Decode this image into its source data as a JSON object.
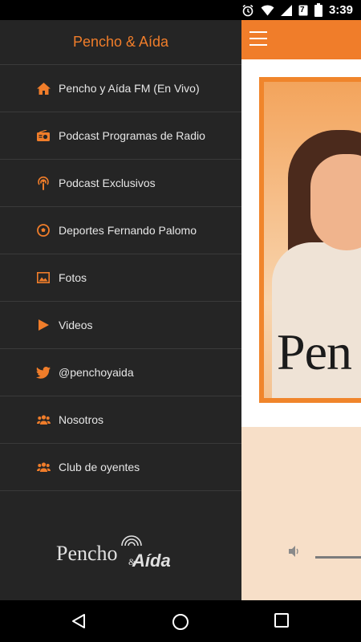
{
  "status_bar": {
    "time": "3:39",
    "icons": [
      "alarm-icon",
      "wifi-icon",
      "signal-icon",
      "calendar-badge-icon",
      "battery-icon"
    ],
    "calendar_badge": "7"
  },
  "drawer": {
    "title": "Pencho & Aída",
    "items": [
      {
        "label": "Pencho y Aída FM (En Vivo)",
        "icon": "home-icon"
      },
      {
        "label": "Podcast Programas de Radio",
        "icon": "radio-icon"
      },
      {
        "label": "Podcast Exclusivos",
        "icon": "podcast-icon"
      },
      {
        "label": "Deportes Fernando Palomo",
        "icon": "soccer-ball-icon"
      },
      {
        "label": "Fotos",
        "icon": "image-icon"
      },
      {
        "label": "Videos",
        "icon": "play-icon"
      },
      {
        "label": "@penchoyaida",
        "icon": "twitter-icon"
      },
      {
        "label": "Nosotros",
        "icon": "group-icon"
      },
      {
        "label": "Club de oyentes",
        "icon": "group-icon"
      }
    ],
    "logo": {
      "part1": "Pencho",
      "part2": "Aída",
      "amp": "&"
    }
  },
  "main": {
    "banner_text": "Pen",
    "colors": {
      "accent": "#f07d2a",
      "drawer_bg": "#252525",
      "player_bg": "#f7dfc8"
    }
  },
  "navbar": {
    "buttons": [
      "back-icon",
      "home-circle-icon",
      "recents-icon"
    ]
  }
}
